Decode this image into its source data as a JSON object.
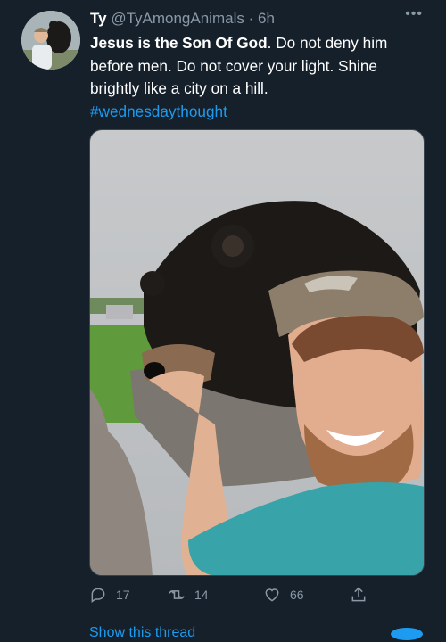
{
  "tweet": {
    "name": "Ty",
    "handle": "@TyAmongAnimals",
    "separator": "·",
    "time": "6h",
    "text_bold": "Jesus is the Son Of God",
    "text_rest": ". Do not deny him before men. Do not cover your light. Shine brightly like a city on a hill.",
    "hashtag": "#wednesdaythought",
    "more_icon": "ellipsis-icon"
  },
  "actions": {
    "reply_count": "17",
    "retweet_count": "14",
    "like_count": "66",
    "reply_icon": "reply-icon",
    "retweet_icon": "retweet-icon",
    "like_icon": "heart-icon",
    "share_icon": "share-icon"
  },
  "thread_link": "Show this thread",
  "colors": {
    "background": "#15202b",
    "link": "#1d9bf0",
    "muted": "#8b98a5"
  }
}
